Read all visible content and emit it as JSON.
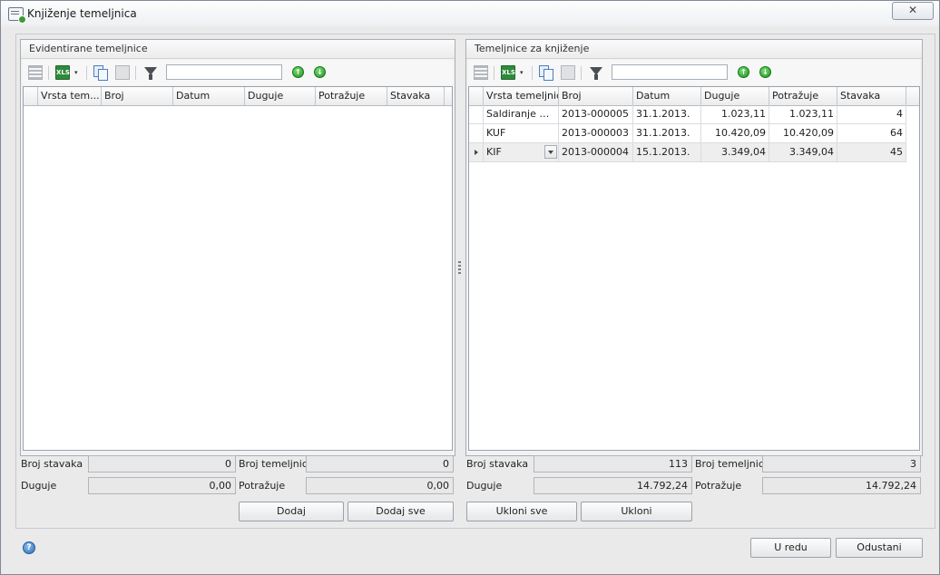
{
  "window": {
    "title": "Knjiženje temeljnica",
    "close_glyph": "✕"
  },
  "left_panel": {
    "title": "Evidentirane temeljnice",
    "search_value": "",
    "columns": [
      "Vrsta tem...",
      "Broj",
      "Datum",
      "Duguje",
      "Potražuje",
      "Stavaka"
    ],
    "rows": [],
    "summary": {
      "broj_stavaka_label": "Broj stavaka",
      "broj_stavaka": "0",
      "broj_temeljnica_label": "Broj temeljnica",
      "broj_temeljnica": "0",
      "duguje_label": "Duguje",
      "duguje": "0,00",
      "potrazuje_label": "Potražuje",
      "potrazuje": "0,00"
    },
    "buttons": {
      "add": "Dodaj",
      "add_all": "Dodaj sve"
    }
  },
  "right_panel": {
    "title": "Temeljnice za knjiženje",
    "search_value": "",
    "columns": [
      "Vrsta temeljnice",
      "Broj",
      "Datum",
      "Duguje",
      "Potražuje",
      "Stavaka"
    ],
    "rows": [
      {
        "vrsta": "Saldiranje PD...",
        "broj": "2013-000005",
        "datum": "31.1.2013.",
        "duguje": "1.023,11",
        "potrazuje": "1.023,11",
        "stavaka": "4"
      },
      {
        "vrsta": "KUF",
        "broj": "2013-000003",
        "datum": "31.1.2013.",
        "duguje": "10.420,09",
        "potrazuje": "10.420,09",
        "stavaka": "64"
      },
      {
        "vrsta": "KIF",
        "broj": "2013-000004",
        "datum": "15.1.2013.",
        "duguje": "3.349,04",
        "potrazuje": "3.349,04",
        "stavaka": "45"
      }
    ],
    "summary": {
      "broj_stavaka_label": "Broj stavaka",
      "broj_stavaka": "113",
      "broj_temeljnica_label": "Broj temeljnica",
      "broj_temeljnica": "3",
      "duguje_label": "Duguje",
      "duguje": "14.792,24",
      "potrazuje_label": "Potražuje",
      "potrazuje": "14.792,24"
    },
    "buttons": {
      "remove_all": "Ukloni sve",
      "remove": "Ukloni"
    }
  },
  "toolbar": {
    "xls_label": "XLS",
    "move_up_glyph": "↑",
    "move_down_glyph": "↓",
    "dropdown_glyph": "▾"
  },
  "footer": {
    "ok": "U redu",
    "cancel": "Odustani",
    "help_glyph": "?"
  }
}
